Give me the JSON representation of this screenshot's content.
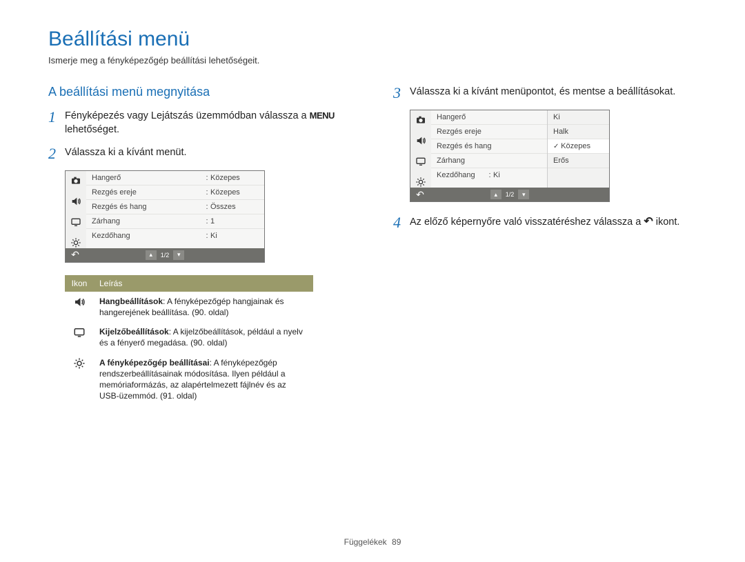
{
  "title": "Beállítási menü",
  "subtitle": "Ismerje meg a fényképezőgép beállítási lehetőségeit.",
  "section_heading": "A beállítási menü megnyitása",
  "menu_word": "MENU",
  "steps": {
    "s1_a": "Fényképezés vagy Lejátszás üzemmódban válassza a ",
    "s1_b": " lehetőséget.",
    "s2": "Válassza ki a kívánt menüt.",
    "s3": "Válassza ki a kívánt menüpontot, és mentse a beállításokat.",
    "s4_a": "Az előző képernyőre való visszatéréshez válassza a ",
    "s4_b": " ikont."
  },
  "lcd1": {
    "rows": [
      {
        "k": "Hangerő",
        "v": "Közepes"
      },
      {
        "k": "Rezgés ereje",
        "v": "Közepes"
      },
      {
        "k": "Rezgés és hang",
        "v": "Összes"
      },
      {
        "k": "Zárhang",
        "v": "1"
      },
      {
        "k": "Kezdőhang",
        "v": "Ki"
      }
    ],
    "page": "1/2"
  },
  "lcd2": {
    "rows": [
      {
        "k": "Hangerő"
      },
      {
        "k": "Rezgés ereje"
      },
      {
        "k": "Rezgés és hang"
      },
      {
        "k": "Zárhang"
      },
      {
        "k": "Kezdőhang",
        "v": "Ki"
      }
    ],
    "options": [
      "Ki",
      "Halk",
      "Közepes",
      "Erős"
    ],
    "selected_index": 2,
    "page": "1/2"
  },
  "table": {
    "head_icon": "Ikon",
    "head_desc": "Leírás",
    "rows": [
      {
        "icon": "sound",
        "bold": "Hangbeállítások",
        "text": ": A fényképezőgép hangjainak és hangerejének beállítása. (90. oldal)"
      },
      {
        "icon": "display",
        "bold": "Kijelzőbeállítások",
        "text": ": A kijelzőbeállítások, például a nyelv és a fényerő megadása. (90. oldal)"
      },
      {
        "icon": "gear",
        "bold": "A fényképezőgép beállításai",
        "text": ": A fényképezőgép rendszerbeállításainak módosítása. Ilyen például a memóriaformázás, az alapértelmezett fájlnév és az USB-üzemmód. (91. oldal)"
      }
    ]
  },
  "footer": {
    "label": "Függelékek",
    "page": "89"
  }
}
